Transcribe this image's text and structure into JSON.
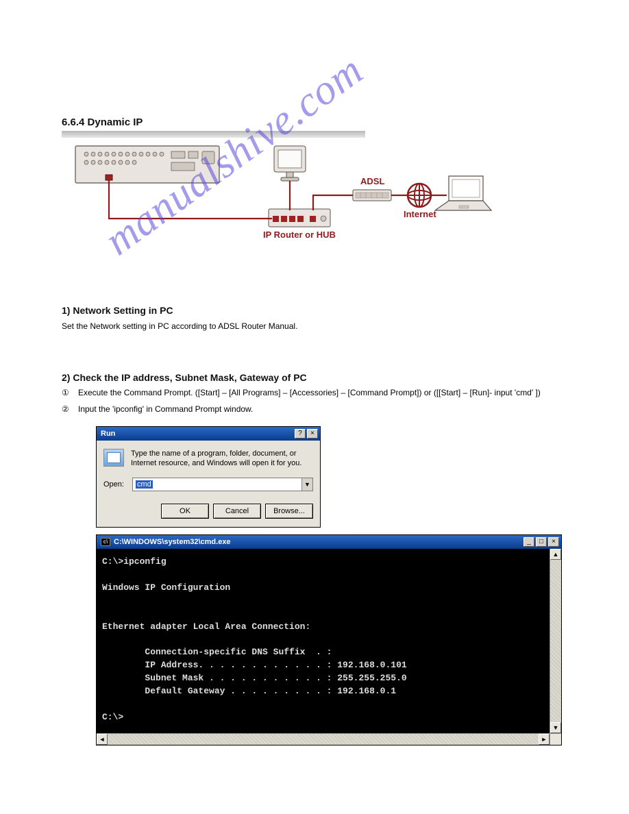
{
  "page": {
    "heading_top": "",
    "section_title": "6.6.4 Dynamic IP",
    "diagram": {
      "adsl_label": "ADSL",
      "internet_label": "Internet",
      "router_label": "IP Router or HUB"
    },
    "sub1": "1) Network Setting in PC",
    "sub1_body": "Set the Network setting in PC according to ADSL Router Manual.",
    "sub2": "2) Check the IP address, Subnet Mask, Gateway of PC",
    "bullet1_num": "①",
    "bullet1_text": "Execute the Command Prompt. ([Start] – [All Programs] – [Accessories] – [Command Prompt]) or ([[Start] – [Run]- input 'cmd' ])",
    "bullet2_num": "②",
    "bullet2_text": "Input the 'ipconfig' in Command Prompt window."
  },
  "run_dialog": {
    "title": "Run",
    "description": "Type the name of a program, folder, document, or Internet resource, and Windows will open it for you.",
    "open_label": "Open:",
    "open_value": "cmd",
    "ok": "OK",
    "cancel": "Cancel",
    "browse": "Browse...",
    "help_btn": "?",
    "close_btn": "×"
  },
  "cmd": {
    "title": "C:\\WINDOWS\\system32\\cmd.exe",
    "minimize": "_",
    "maximize": "□",
    "close": "×",
    "up": "▲",
    "down": "▼",
    "left": "◄",
    "right": "►",
    "line1": "C:\\>ipconfig",
    "line2": "Windows IP Configuration",
    "line3": "Ethernet adapter Local Area Connection:",
    "line4": "        Connection-specific DNS Suffix  . :",
    "line5": "        IP Address. . . . . . . . . . . . : 192.168.0.101",
    "line6": "        Subnet Mask . . . . . . . . . . . : 255.255.255.0",
    "line7": "        Default Gateway . . . . . . . . . : 192.168.0.1",
    "line8": "C:\\>"
  },
  "watermark": "manualshive.com"
}
